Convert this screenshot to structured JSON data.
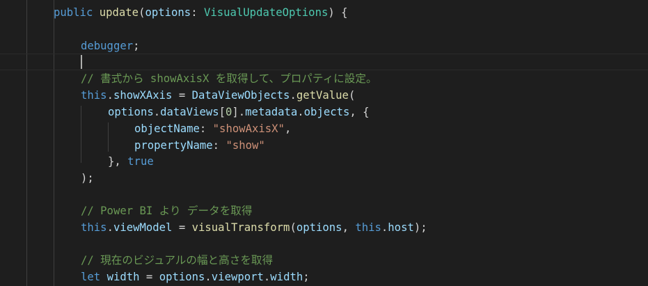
{
  "theme": {
    "background": "#1e1e1e",
    "keyword": "#569cd6",
    "function": "#dcdcaa",
    "property": "#9cdcfe",
    "type": "#4ec9b0",
    "string": "#ce9178",
    "number": "#b5cea8",
    "comment": "#6a9955",
    "text": "#d4d4d4"
  },
  "code": {
    "l1": {
      "kw": "public",
      "fn": "update",
      "p1": "(",
      "param": "options",
      "p2": ": ",
      "type": "VisualUpdateOptions",
      "p3": ") {"
    },
    "l3": {
      "kw": "debugger",
      "p": ";"
    },
    "l5": {
      "cmt": "// 書式から showAxisX を取得して、プロパティに設定。"
    },
    "l6": {
      "kw": "this",
      "p1": ".",
      "prop": "showXAxis",
      "p2": " = ",
      "prop2": "DataViewObjects",
      "p3": ".",
      "fn": "getValue",
      "p4": "("
    },
    "l7": {
      "prop1": "options",
      "p1": ".",
      "prop2": "dataViews",
      "p2": "[",
      "num": "0",
      "p3": "].",
      "prop3": "metadata",
      "p4": ".",
      "prop4": "objects",
      "p5": ", {"
    },
    "l8": {
      "prop": "objectName",
      "p1": ": ",
      "str": "\"showAxisX\"",
      "p2": ","
    },
    "l9": {
      "prop": "propertyName",
      "p1": ": ",
      "str": "\"show\""
    },
    "l10": {
      "p1": "}, ",
      "kw": "true"
    },
    "l11": {
      "p": ");"
    },
    "l13": {
      "cmt": "// Power BI より データを取得"
    },
    "l14": {
      "kw1": "this",
      "p1": ".",
      "prop1": "viewModel",
      "p2": " = ",
      "fn": "visualTransform",
      "p3": "(",
      "prop2": "options",
      "p4": ", ",
      "kw2": "this",
      "p5": ".",
      "prop3": "host",
      "p6": ");"
    },
    "l16": {
      "cmt": "// 現在のビジュアルの幅と高さを取得"
    },
    "l17": {
      "kw": "let",
      "sp": " ",
      "prop1": "width",
      "p1": " = ",
      "prop2": "options",
      "p2": ".",
      "prop3": "viewport",
      "p3": ".",
      "prop4": "width",
      "p4": ";"
    }
  }
}
